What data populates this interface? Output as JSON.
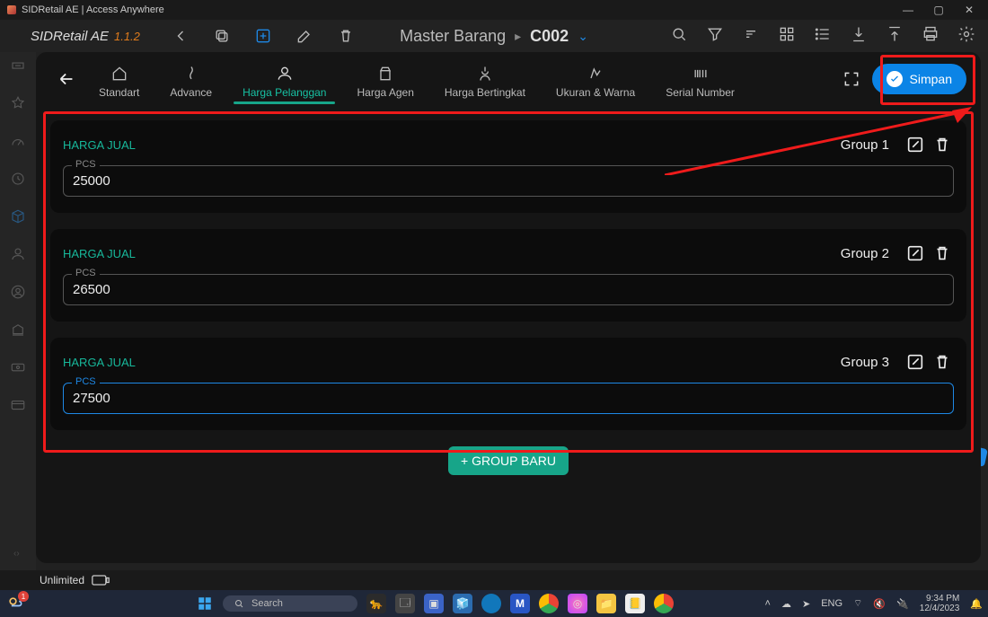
{
  "window": {
    "title": "SIDRetail AE | Access Anywhere"
  },
  "brand": {
    "name": "SIDRetail AE",
    "version": "1.1.2"
  },
  "header": {
    "breadcrumb": "Master Barang",
    "code": "C002"
  },
  "tabs": {
    "standart": "Standart",
    "advance": "Advance",
    "harga_pelanggan": "Harga Pelanggan",
    "harga_agen": "Harga Agen",
    "harga_bertingkat": "Harga Bertingkat",
    "ukuran_warna": "Ukuran & Warna",
    "serial_number": "Serial Number"
  },
  "save_label": "Simpan",
  "groups": [
    {
      "title": "HARGA JUAL",
      "unit": "PCS",
      "value": "25000",
      "name": "Group 1"
    },
    {
      "title": "HARGA JUAL",
      "unit": "PCS",
      "value": "26500",
      "name": "Group 2"
    },
    {
      "title": "HARGA JUAL",
      "unit": "PCS",
      "value": "27500",
      "name": "Group 3"
    }
  ],
  "add_group_label": "+ GROUP BARU",
  "status": {
    "plan": "Unlimited"
  },
  "taskbar": {
    "search_placeholder": "Search",
    "lang": "ENG",
    "time": "9:34 PM",
    "date": "12/4/2023"
  }
}
